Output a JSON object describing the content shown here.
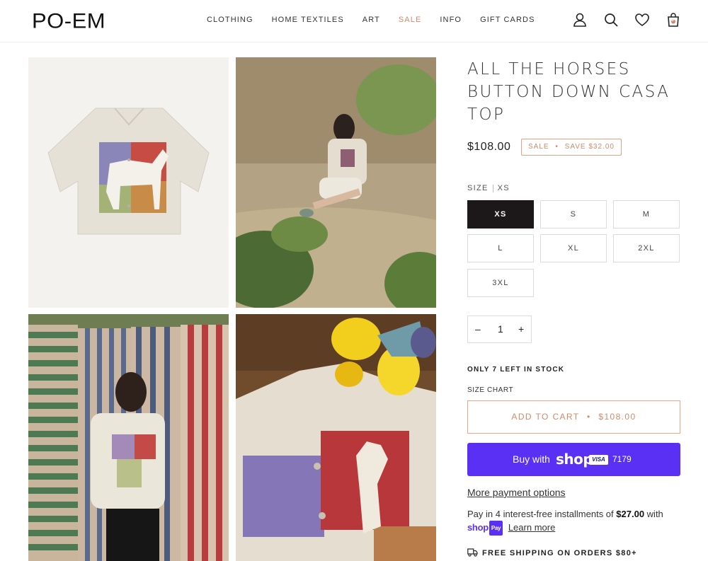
{
  "brand": {
    "logo": "PO-EM"
  },
  "nav": {
    "items": [
      {
        "label": "CLOTHING"
      },
      {
        "label": "HOME TEXTILES"
      },
      {
        "label": "ART"
      },
      {
        "label": "SALE"
      },
      {
        "label": "INFO"
      },
      {
        "label": "GIFT CARDS"
      }
    ]
  },
  "header_icons": [
    "account-icon",
    "search-icon",
    "wishlist-heart-icon",
    "cart-bag-icon"
  ],
  "cart": {
    "count": "0"
  },
  "gallery": {
    "images": [
      "product-flat-lay",
      "model-seated-on-sand",
      "model-before-striped-textiles",
      "shirt-close-up-with-daffodils"
    ]
  },
  "product": {
    "title": "ALL THE HORSES BUTTON DOWN CASA TOP",
    "price": "$108.00",
    "badge_sale": "SALE",
    "badge_dot": "•",
    "badge_save": "SAVE $32.00",
    "size_label": "SIZE",
    "selected_size": "XS",
    "sizes": [
      "XS",
      "S",
      "M",
      "L",
      "XL",
      "2XL",
      "3XL"
    ],
    "quantity": "1",
    "qty_minus": "–",
    "qty_plus": "+",
    "stock_note": "ONLY 7 LEFT IN STOCK",
    "size_chart": "SIZE CHART",
    "add_to_cart": "ADD TO CART",
    "add_to_cart_dot": "•",
    "add_to_cart_price": "$108.00"
  },
  "shop_pay": {
    "buy_with": "Buy with",
    "shop_word": "shop",
    "card_brand": "VISA",
    "card_digits": "7179",
    "more_options": "More payment options",
    "install_prefix": "Pay in 4 interest-free installments of",
    "install_amount": "$27.00",
    "install_suffix": "with",
    "logo_shop": "shop",
    "logo_pay": "Pay",
    "learn_more": "Learn more"
  },
  "shipping": {
    "text": "FREE SHIPPING ON ORDERS $80+"
  },
  "colors": {
    "accent_sale": "#d08a6b",
    "shop_pay_purple": "#5a31f4",
    "selected_size_bg": "#1c1819"
  }
}
